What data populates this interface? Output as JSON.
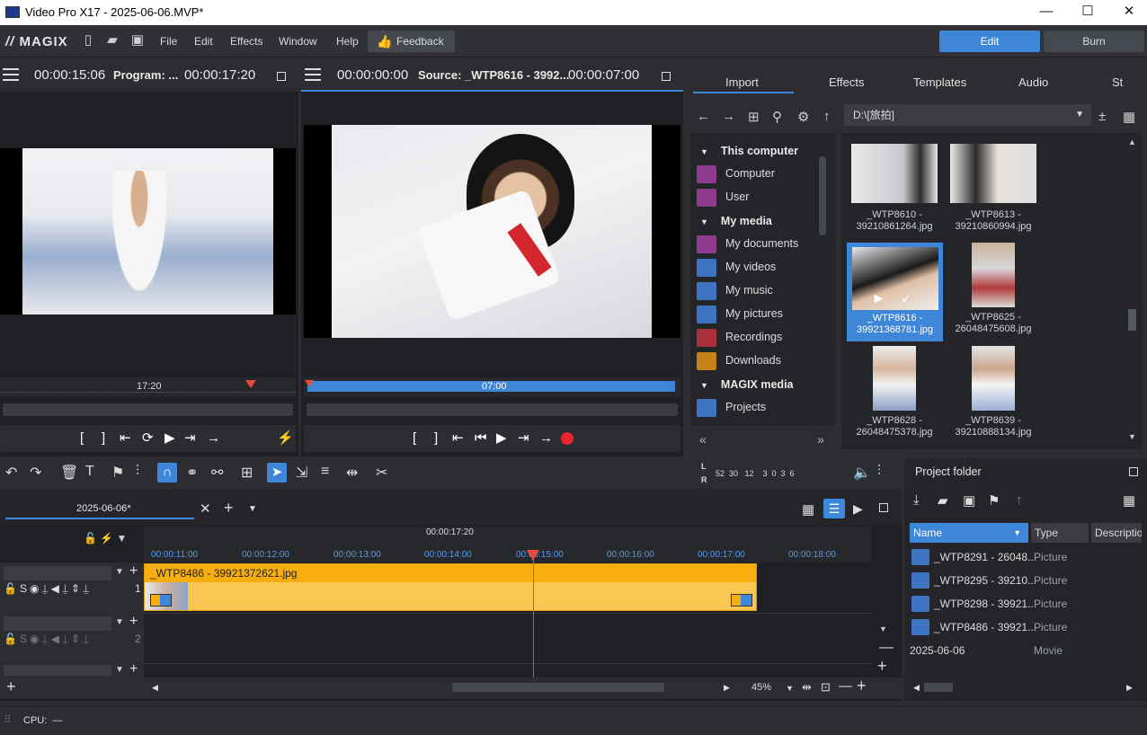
{
  "window": {
    "title": "Video Pro X17 - 2025-06-06.MVP*"
  },
  "menu": {
    "logo": "MAGIX",
    "items": [
      "File",
      "Edit",
      "Effects",
      "Window",
      "Help"
    ],
    "feedback": "Feedback",
    "edit": "Edit",
    "burn": "Burn"
  },
  "program_monitor": {
    "tc_left": "00:00:15:06",
    "label": "Program: ...",
    "tc_right": "00:00:17:20",
    "ruler_label": "17:20"
  },
  "source_monitor": {
    "tc_left": "00:00:00:00",
    "label": "Source: _WTP8616 - 3992...",
    "tc_right": "00:00:07:00",
    "ruler_label": "07:00"
  },
  "media": {
    "tabs": [
      "Import",
      "Effects",
      "Templates",
      "Audio",
      "St"
    ],
    "path": "D:\\[旅拍]"
  },
  "tree": {
    "computer_head": "This computer",
    "computer": "Computer",
    "user": "User",
    "mymedia_head": "My media",
    "documents": "My documents",
    "videos": "My videos",
    "music": "My music",
    "pictures": "My pictures",
    "recordings": "Recordings",
    "downloads": "Downloads",
    "magix_head": "MAGIX media",
    "projects": "Projects"
  },
  "thumbs": [
    {
      "l1": "_WTP8610 -",
      "l2": "39210861264.jpg"
    },
    {
      "l1": "_WTP8613 -",
      "l2": "39210860994.jpg"
    },
    {
      "l1": "_WTP8616 -",
      "l2": "39921368781.jpg"
    },
    {
      "l1": "_WTP8625 -",
      "l2": "26048475608.jpg"
    },
    {
      "l1": "_WTP8628 -",
      "l2": "26048475378.jpg"
    },
    {
      "l1": "_WTP8639 -",
      "l2": "39210888134.jpg"
    }
  ],
  "meter": {
    "labels": [
      "L",
      "R"
    ],
    "ticks": "52  30   12    3  0  3  6"
  },
  "timeline": {
    "tab": "2025-06-06*",
    "cursor_tc": "00:00:17:20",
    "ticks": [
      "00:00:11:00",
      "00:00:12:00",
      "00:00:13:00",
      "00:00:14:00",
      "00:00:15:00",
      "00:00:16:00",
      "00:00:17:00",
      "00:00:18:00"
    ],
    "clip_title": "_WTP8486 - 39921372621.jpg",
    "track1": "1",
    "track2": "2",
    "zoom": "45%"
  },
  "project": {
    "title": "Project folder",
    "cols": [
      "Name",
      "Type",
      "Descriptio"
    ],
    "rows": [
      {
        "name": "_WTP8291 - 26048...",
        "type": "Picture"
      },
      {
        "name": "_WTP8295 - 39210...",
        "type": "Picture"
      },
      {
        "name": "_WTP8298 - 39921...",
        "type": "Picture"
      },
      {
        "name": "_WTP8486 - 39921...",
        "type": "Picture"
      },
      {
        "name": "2025-06-06",
        "type": "Movie"
      }
    ]
  },
  "status": {
    "cpu": "CPU:  —"
  }
}
